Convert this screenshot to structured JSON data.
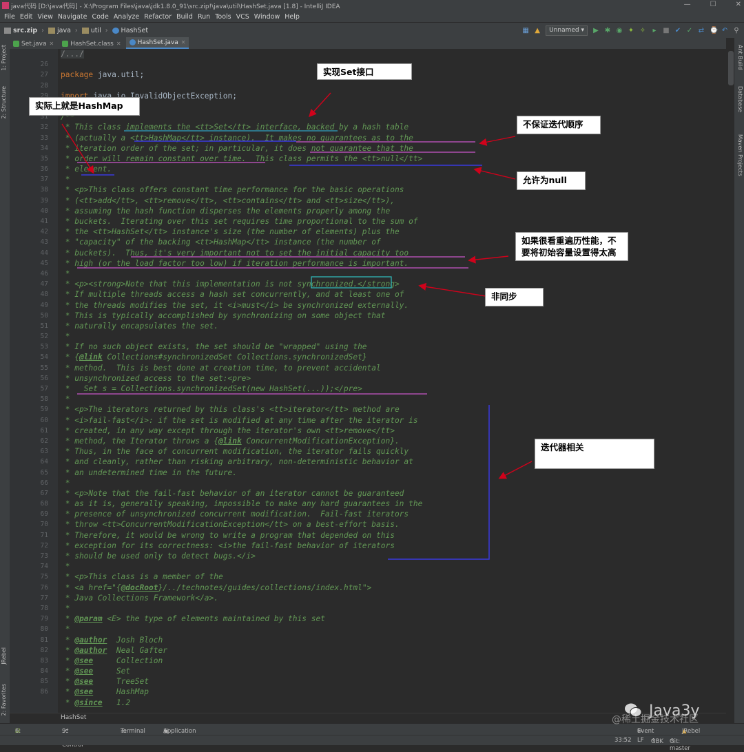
{
  "window": {
    "title": "java代码 [D:\\java代码] - X:\\Program Files\\java\\jdk1.8.0_91\\src.zip!\\java\\util\\HashSet.java [1.8] - IntelliJ IDEA",
    "min": "—",
    "max": "☐",
    "close": "✕"
  },
  "menu": [
    "File",
    "Edit",
    "View",
    "Navigate",
    "Code",
    "Analyze",
    "Refactor",
    "Build",
    "Run",
    "Tools",
    "VCS",
    "Window",
    "Help"
  ],
  "nav": {
    "crumbs": [
      "src.zip",
      "java",
      "util",
      "HashSet"
    ],
    "run_config": "Unnamed"
  },
  "tabs": [
    {
      "label": "Set.java",
      "active": false,
      "color": "#4ca34c"
    },
    {
      "label": "HashSet.class",
      "active": false,
      "color": "#4ca34c"
    },
    {
      "label": "HashSet.java",
      "active": true,
      "color": "#4a88c7"
    }
  ],
  "side": {
    "left": [
      "1: Project",
      "2: Structure",
      "JRebel",
      "2: Favorites"
    ],
    "right": [
      "Ant Build",
      "Database",
      "Maven Projects"
    ]
  },
  "line_numbers": [
    "",
    "26",
    "27",
    "28",
    "29",
    "30",
    "31",
    "32",
    "33",
    "34",
    "35",
    "36",
    "37",
    "38",
    "39",
    "40",
    "41",
    "42",
    "43",
    "44",
    "45",
    "46",
    "47",
    "48",
    "49",
    "50",
    "51",
    "52",
    "53",
    "54",
    "55",
    "56",
    "57",
    "58",
    "59",
    "60",
    "61",
    "62",
    "63",
    "64",
    "65",
    "66",
    "67",
    "68",
    "69",
    "70",
    "71",
    "72",
    "73",
    "74",
    "75",
    "76",
    "77",
    "78",
    "79",
    "80",
    "81",
    "82",
    "83",
    "84",
    "85",
    "86"
  ],
  "code": [
    {
      "t": "fold",
      "s": "/.../"
    },
    {
      "t": "blank",
      "s": ""
    },
    {
      "t": "pkg",
      "kw": "package",
      "s": " java.util;"
    },
    {
      "t": "blank",
      "s": ""
    },
    {
      "t": "imp",
      "kw": "import",
      "s": " java.io.InvalidObjectException;"
    },
    {
      "t": "blank",
      "s": ""
    },
    {
      "t": "doc",
      "s": "/**"
    },
    {
      "t": "doc",
      "s": " * This class implements the <tt>Set</tt> interface, backed by a hash table"
    },
    {
      "t": "doc",
      "s": " * (actually a <tt>HashMap</tt> instance).  It makes no guarantees as to the"
    },
    {
      "t": "doc",
      "s": " * iteration order of the set; in particular, it does not guarantee that the"
    },
    {
      "t": "doc",
      "s": " * order will remain constant over time.  This class permits the <tt>null</tt>"
    },
    {
      "t": "doc",
      "s": " * element."
    },
    {
      "t": "doc",
      "s": " *"
    },
    {
      "t": "doc",
      "s": " * <p>This class offers constant time performance for the basic operations"
    },
    {
      "t": "doc",
      "s": " * (<tt>add</tt>, <tt>remove</tt>, <tt>contains</tt> and <tt>size</tt>),"
    },
    {
      "t": "doc",
      "s": " * assuming the hash function disperses the elements properly among the"
    },
    {
      "t": "doc",
      "s": " * buckets.  Iterating over this set requires time proportional to the sum of"
    },
    {
      "t": "doc",
      "s": " * the <tt>HashSet</tt> instance's size (the number of elements) plus the"
    },
    {
      "t": "doc",
      "s": " * \"capacity\" of the backing <tt>HashMap</tt> instance (the number of"
    },
    {
      "t": "doc",
      "s": " * buckets).  Thus, it's very important not to set the initial capacity too"
    },
    {
      "t": "doc",
      "s": " * high (or the load factor too low) if iteration performance is important."
    },
    {
      "t": "doc",
      "s": " *"
    },
    {
      "t": "doc",
      "s": " * <p><strong>Note that this implementation is not synchronized.</strong>"
    },
    {
      "t": "doc",
      "s": " * If multiple threads access a hash set concurrently, and at least one of"
    },
    {
      "t": "doc",
      "s": " * the threads modifies the set, it <i>must</i> be synchronized externally."
    },
    {
      "t": "doc",
      "s": " * This is typically accomplished by synchronizing on some object that"
    },
    {
      "t": "doc",
      "s": " * naturally encapsulates the set."
    },
    {
      "t": "doc",
      "s": " *"
    },
    {
      "t": "doc",
      "s": " * If no such object exists, the set should be \"wrapped\" using the"
    },
    {
      "t": "tag",
      "pre": " * {",
      "tag": "@link",
      "post": " Collections#synchronizedSet Collections.synchronizedSet}"
    },
    {
      "t": "doc",
      "s": " * method.  This is best done at creation time, to prevent accidental"
    },
    {
      "t": "doc",
      "s": " * unsynchronized access to the set:<pre>"
    },
    {
      "t": "doc",
      "s": " *   Set s = Collections.synchronizedSet(new HashSet(...));</pre>"
    },
    {
      "t": "doc",
      "s": " *"
    },
    {
      "t": "doc",
      "s": " * <p>The iterators returned by this class's <tt>iterator</tt> method are"
    },
    {
      "t": "doc",
      "s": " * <i>fail-fast</i>: if the set is modified at any time after the iterator is"
    },
    {
      "t": "doc",
      "s": " * created, in any way except through the iterator's own <tt>remove</tt>"
    },
    {
      "t": "tag",
      "pre": " * method, the Iterator throws a {",
      "tag": "@link",
      "post": " ConcurrentModificationException}."
    },
    {
      "t": "doc",
      "s": " * Thus, in the face of concurrent modification, the iterator fails quickly"
    },
    {
      "t": "doc",
      "s": " * and cleanly, rather than risking arbitrary, non-deterministic behavior at"
    },
    {
      "t": "doc",
      "s": " * an undetermined time in the future."
    },
    {
      "t": "doc",
      "s": " *"
    },
    {
      "t": "doc",
      "s": " * <p>Note that the fail-fast behavior of an iterator cannot be guaranteed"
    },
    {
      "t": "doc",
      "s": " * as it is, generally speaking, impossible to make any hard guarantees in the"
    },
    {
      "t": "doc",
      "s": " * presence of unsynchronized concurrent modification.  Fail-fast iterators"
    },
    {
      "t": "doc",
      "s": " * throw <tt>ConcurrentModificationException</tt> on a best-effort basis."
    },
    {
      "t": "doc",
      "s": " * Therefore, it would be wrong to write a program that depended on this"
    },
    {
      "t": "doc",
      "s": " * exception for its correctness: <i>the fail-fast behavior of iterators"
    },
    {
      "t": "doc",
      "s": " * should be used only to detect bugs.</i>"
    },
    {
      "t": "doc",
      "s": " *"
    },
    {
      "t": "doc",
      "s": " * <p>This class is a member of the"
    },
    {
      "t": "tag",
      "pre": " * <a href=\"{",
      "tag": "@docRoot",
      "post": "}/../technotes/guides/collections/index.html\">"
    },
    {
      "t": "doc",
      "s": " * Java Collections Framework</a>."
    },
    {
      "t": "doc",
      "s": " *"
    },
    {
      "t": "tag",
      "pre": " * ",
      "tag": "@param",
      "post": " <E> the type of elements maintained by this set"
    },
    {
      "t": "doc",
      "s": " *"
    },
    {
      "t": "tag",
      "pre": " * ",
      "tag": "@author",
      "post": "  Josh Bloch"
    },
    {
      "t": "tag",
      "pre": " * ",
      "tag": "@author",
      "post": "  Neal Gafter"
    },
    {
      "t": "tag",
      "pre": " * ",
      "tag": "@see",
      "post": "     Collection"
    },
    {
      "t": "tag",
      "pre": " * ",
      "tag": "@see",
      "post": "     Set"
    },
    {
      "t": "tag",
      "pre": " * ",
      "tag": "@see",
      "post": "     TreeSet"
    },
    {
      "t": "tag",
      "pre": " * ",
      "tag": "@see",
      "post": "     HashMap"
    },
    {
      "t": "tag",
      "pre": " * ",
      "tag": "@since",
      "post": "   1.2"
    }
  ],
  "annotations": {
    "implements_set": "实现Set接口",
    "actually_hashmap": "实际上就是HashMap",
    "no_order": "不保证迭代顺序",
    "allows_null": "允许为null",
    "capacity_line1": "如果很看重遍历性能，不",
    "capacity_line2": "要将初始容量设置得太高",
    "not_sync": "非同步",
    "iterator": "迭代器相关"
  },
  "bottom": {
    "breadcrumb": "HashSet",
    "tools": [
      "6: TODO",
      "9: Version Control",
      "Terminal",
      "Application Servers"
    ],
    "event_log": "Event Log",
    "jrebel_console": "JRebel Console",
    "position": "33:52",
    "line_sep": "LF",
    "encoding": "GBK",
    "git": "Git: master"
  },
  "watermark": {
    "text": "Java3y",
    "sub": "@稀土掘金技术社区"
  }
}
